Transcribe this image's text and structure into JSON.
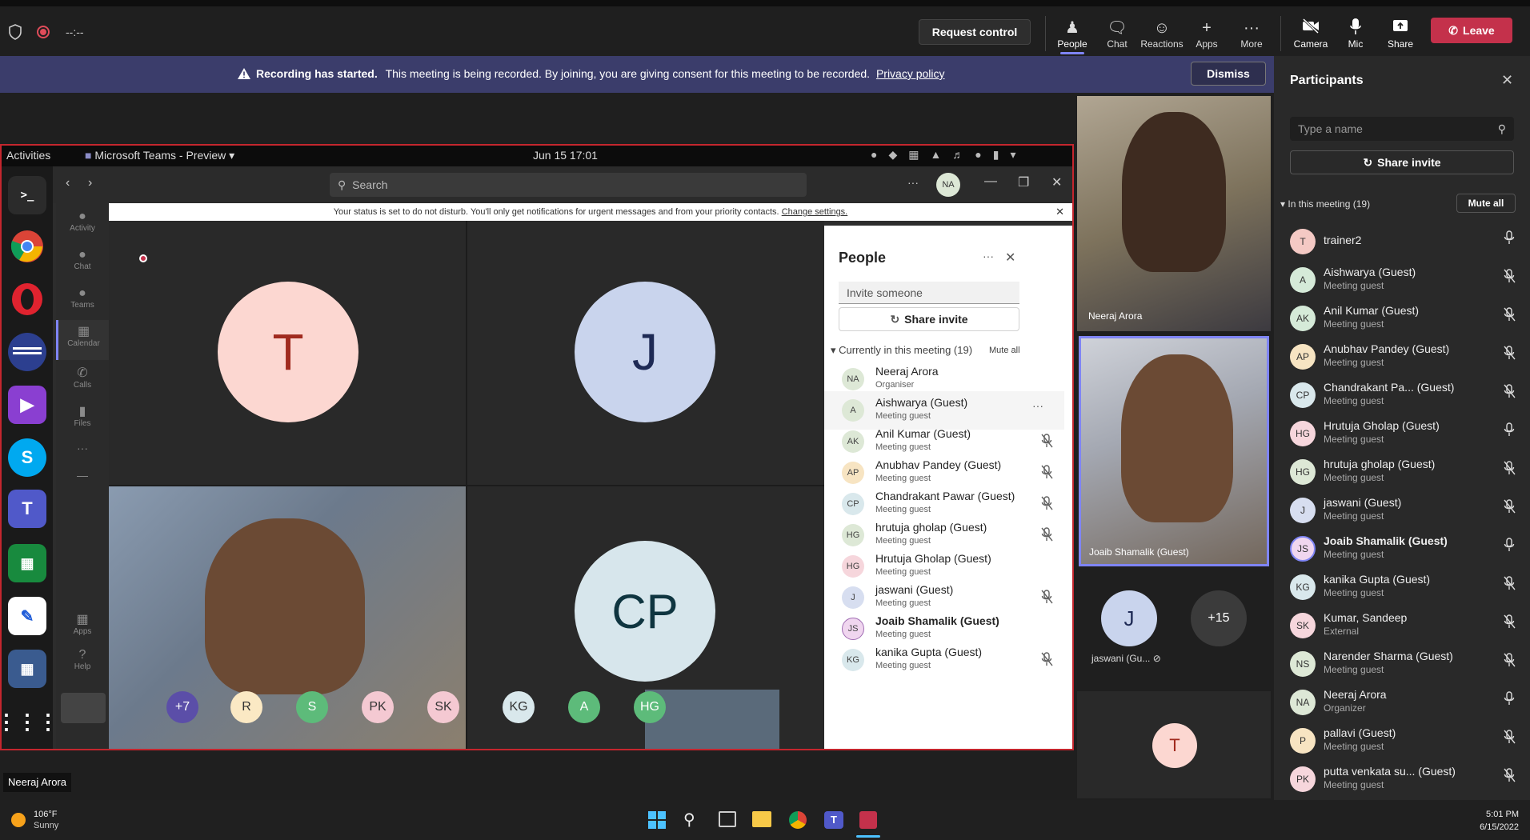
{
  "topbar": {
    "timer": "--:--",
    "request_control": "Request control",
    "buttons": [
      "People",
      "Chat",
      "Reactions",
      "Apps",
      "More",
      "Camera",
      "Mic",
      "Share"
    ],
    "leave": "Leave"
  },
  "banner": {
    "bold": "Recording has started.",
    "text": "This meeting is being recorded. By joining, you are giving consent for this meeting to be recorded.",
    "link": "Privacy policy",
    "dismiss": "Dismiss"
  },
  "right_panel": {
    "title": "Participants",
    "search_placeholder": "Type a name",
    "share_invite": "Share invite",
    "section": "In this meeting (19)",
    "mute_all": "Mute all",
    "participants": [
      {
        "initials": "T",
        "name": "trainer2",
        "role": "",
        "bg": "#f4c9c4"
      },
      {
        "initials": "A",
        "name": "Aishwarya (Guest)",
        "role": "Meeting guest",
        "bg": "#d5ead8"
      },
      {
        "initials": "AK",
        "name": "Anil Kumar (Guest)",
        "role": "Meeting guest",
        "bg": "#d5ead8"
      },
      {
        "initials": "AP",
        "name": "Anubhav Pandey (Guest)",
        "role": "Meeting guest",
        "bg": "#f7e4c2"
      },
      {
        "initials": "CP",
        "name": "Chandrakant Pa...  (Guest)",
        "role": "Meeting guest",
        "bg": "#d9e8ec"
      },
      {
        "initials": "HG",
        "name": "Hrutuja Gholap (Guest)",
        "role": "Meeting guest",
        "bg": "#f6d6dc"
      },
      {
        "initials": "HG",
        "name": "hrutuja gholap (Guest)",
        "role": "Meeting guest",
        "bg": "#dde8d6"
      },
      {
        "initials": "J",
        "name": "jaswani (Guest)",
        "role": "Meeting guest",
        "bg": "#d7def0"
      },
      {
        "initials": "JS",
        "name": "Joaib Shamalik (Guest)",
        "role": "Meeting guest",
        "bg": "#f0d6ef"
      },
      {
        "initials": "KG",
        "name": "kanika Gupta (Guest)",
        "role": "Meeting guest",
        "bg": "#d9e8ec"
      },
      {
        "initials": "SK",
        "name": "Kumar, Sandeep",
        "role": "External",
        "bg": "#f6d6dc"
      },
      {
        "initials": "NS",
        "name": "Narender Sharma (Guest)",
        "role": "Meeting guest",
        "bg": "#dde8d6"
      },
      {
        "initials": "NA",
        "name": "Neeraj Arora",
        "role": "Organizer",
        "bg": "#dde8d6"
      },
      {
        "initials": "P",
        "name": "pallavi (Guest)",
        "role": "Meeting guest",
        "bg": "#f7e4c2"
      },
      {
        "initials": "PK",
        "name": "putta venkata su...  (Guest)",
        "role": "Meeting guest",
        "bg": "#f6d6dc"
      }
    ]
  },
  "stage": {
    "video1_name": "Neeraj Arora",
    "video2_name": "Joaib Shamalik (Guest)",
    "small_j_name": "jaswani (Gu...",
    "more_count": "+15",
    "bottom_avatar": "T",
    "j_letter": "J"
  },
  "shared_screen": {
    "activities": "Activities",
    "app_name": "Microsoft Teams - Preview",
    "datetime": "Jun 15  17:01",
    "search_placeholder": "Search",
    "user_initials": "NA",
    "status_text": "Your status is set to do not disturb. You'll only get notifications for urgent messages and from your priority contacts.",
    "status_link": "Change settings.",
    "rail": [
      "Activity",
      "Chat",
      "Teams",
      "Calendar",
      "Calls",
      "Files",
      "Apps",
      "Help"
    ],
    "tiles": {
      "t": "T",
      "j": "J",
      "cp": "CP"
    },
    "bottom_avatars": [
      {
        "label": "+7",
        "bg": "#5b4ea8",
        "color": "#ffffff"
      },
      {
        "label": "R",
        "bg": "#fbe9c4",
        "color": "#333333"
      },
      {
        "label": "S",
        "bg": "#5dbb7a",
        "color": "#ffffff"
      },
      {
        "label": "PK",
        "bg": "#f4c9d2",
        "color": "#333333"
      },
      {
        "label": "SK",
        "bg": "#f4c9d2",
        "color": "#333333"
      },
      {
        "label": "KG",
        "bg": "#d9e8ec",
        "color": "#333333"
      },
      {
        "label": "A",
        "bg": "#5dbb7a",
        "color": "#ffffff"
      },
      {
        "label": "HG",
        "bg": "#5dbb7a",
        "color": "#ffffff"
      }
    ],
    "people": {
      "title": "People",
      "invite_placeholder": "Invite someone",
      "share_invite": "Share invite",
      "section": "Currently in this meeting (19)",
      "mute_all": "Mute all",
      "list": [
        {
          "initials": "NA",
          "name": "Neeraj Arora",
          "role": "Organiser",
          "bg": "#dde8d6"
        },
        {
          "initials": "A",
          "name": "Aishwarya (Guest)",
          "role": "Meeting guest",
          "bg": "#dde8d6"
        },
        {
          "initials": "AK",
          "name": "Anil Kumar (Guest)",
          "role": "Meeting guest",
          "bg": "#dde8d6"
        },
        {
          "initials": "AP",
          "name": "Anubhav Pandey (Guest)",
          "role": "Meeting guest",
          "bg": "#f7e4c2"
        },
        {
          "initials": "CP",
          "name": "Chandrakant Pawar (Guest)",
          "role": "Meeting guest",
          "bg": "#d9e8ec"
        },
        {
          "initials": "HG",
          "name": "hrutuja gholap (Guest)",
          "role": "Meeting guest",
          "bg": "#dde8d6"
        },
        {
          "initials": "HG",
          "name": "Hrutuja Gholap (Guest)",
          "role": "Meeting guest",
          "bg": "#f6d6dc"
        },
        {
          "initials": "J",
          "name": "jaswani (Guest)",
          "role": "Meeting guest",
          "bg": "#d7def0"
        },
        {
          "initials": "JS",
          "name": "Joaib Shamalik (Guest)",
          "role": "Meeting guest",
          "bg": "#f0d6ef"
        },
        {
          "initials": "KG",
          "name": "kanika Gupta (Guest)",
          "role": "Meeting guest",
          "bg": "#d9e8ec"
        }
      ]
    }
  },
  "tooltip": "Neeraj Arora",
  "taskbar": {
    "temp": "106°F",
    "weather": "Sunny",
    "time": "5:01 PM",
    "date": "6/15/2022"
  }
}
